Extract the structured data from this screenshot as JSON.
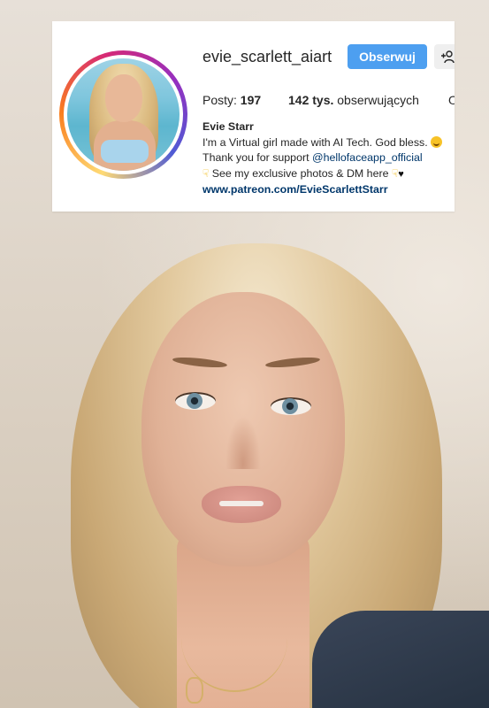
{
  "profile": {
    "username": "evie_scarlett_aiart",
    "follow_label": "Obserwuj",
    "add_user_icon": "add-user-icon",
    "stats": {
      "posts_label": "Posty:",
      "posts_value": "197",
      "followers_value": "142 tys.",
      "followers_label": "obserwujących",
      "following_partial": "O"
    },
    "bio": {
      "name": "Evie Starr",
      "line1": "I'm a Virtual girl made with AI Tech. God bless.",
      "line2_prefix": "Thank you for support",
      "line2_mention": "@hellofaceapp_official",
      "line3": "See my exclusive photos & DM here",
      "link": "www.patreon.com/EvieScarlettStarr"
    },
    "colors": {
      "follow_button": "#4d9ff0",
      "link": "#00376b",
      "text": "#262626"
    }
  }
}
